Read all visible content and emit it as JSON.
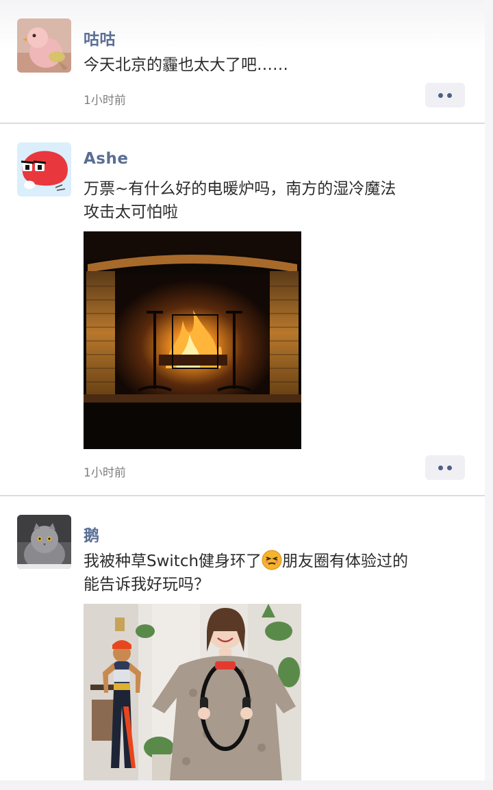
{
  "posts": [
    {
      "author": "咕咕",
      "text": "今天北京的霾也太大了吧……",
      "time": "1小时前",
      "avatar_icon": "pink-bird-avatar"
    },
    {
      "author": "Ashe",
      "text_line1": "万票~有什么好的电暖炉吗，南方的湿冷魔法",
      "text_line2": "攻击太可怕啦",
      "time": "1小时前",
      "avatar_icon": "red-blob-cartoon-avatar",
      "photo": "fireplace-photo"
    },
    {
      "author": "鹅",
      "text_line1_a": "我被种草Switch健身环了",
      "text_line1_b": "朋友圈有体验过的",
      "text_line2": "能告诉我好玩吗？",
      "emoji": "dizzy-face-emoji",
      "avatar_icon": "gray-cat-avatar",
      "photo": "ring-fit-promo-photo"
    }
  ],
  "colors": {
    "name": "#5a6e94",
    "text": "#2c2c2c",
    "time": "#7d7d80",
    "more_dots": "#4f6087"
  }
}
